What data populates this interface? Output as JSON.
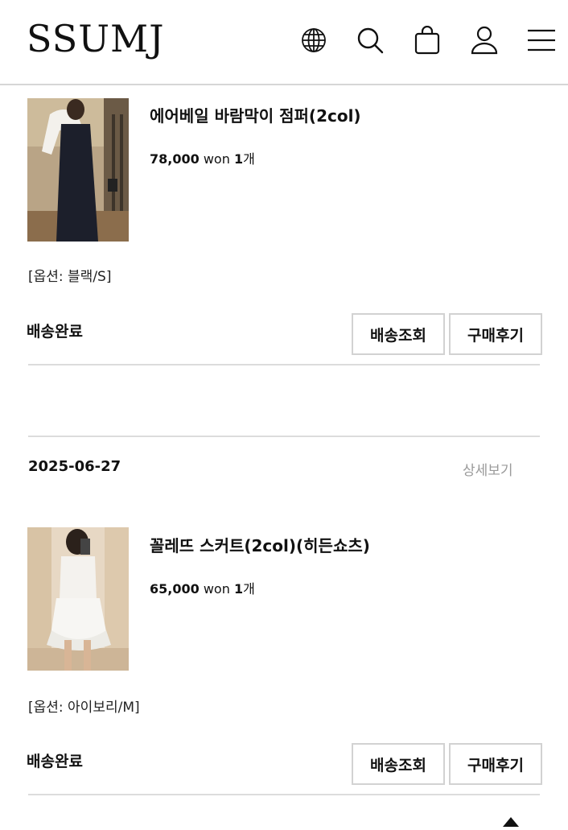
{
  "header": {
    "logo": "SSUMJ",
    "icons": [
      "globe-icon",
      "search-icon",
      "shopping-bag-icon",
      "user-icon",
      "menu-icon"
    ]
  },
  "orders": [
    {
      "product_name": "에어베일 바람막이 점퍼(2col)",
      "price": "78,000",
      "currency": "won",
      "quantity": "1",
      "quantity_unit": "개",
      "option": "[옵션: 블랙/S]",
      "status": "배송완료",
      "track_button": "배송조회",
      "review_button": "구매후기"
    },
    {
      "date": "2025-06-27",
      "detail_link": "상세보기",
      "product_name": "꼴레뜨 스커트(2col)(히든쇼츠)",
      "price": "65,000",
      "currency": "won",
      "quantity": "1",
      "quantity_unit": "개",
      "option": "[옵션: 아이보리/M]",
      "status": "배송완료",
      "track_button": "배송조회",
      "review_button": "구매후기"
    }
  ]
}
